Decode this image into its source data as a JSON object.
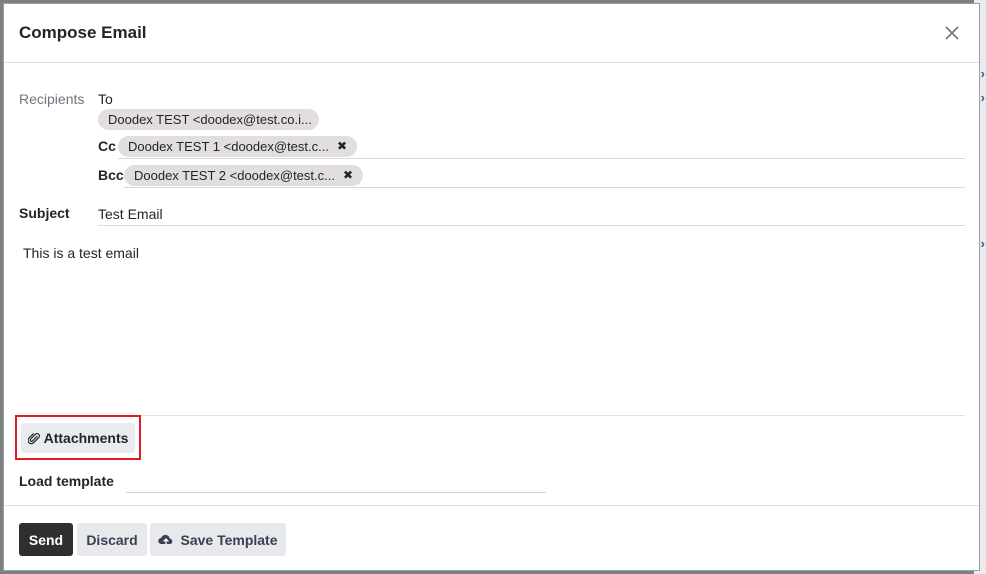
{
  "dialog": {
    "title": "Compose Email"
  },
  "recipients": {
    "section_label": "Recipients",
    "to_label": "To",
    "cc_label": "Cc",
    "bcc_label": "Bcc",
    "to": [
      "Doodex TEST <doodex@test.co.i..."
    ],
    "cc": [
      "Doodex TEST 1 <doodex@test.c..."
    ],
    "bcc": [
      "Doodex TEST 2 <doodex@test.c..."
    ]
  },
  "subject": {
    "label": "Subject",
    "value": "Test Email"
  },
  "message": {
    "body": "This is a test email"
  },
  "attachments": {
    "label": "Attachments"
  },
  "template": {
    "load_label": "Load template",
    "value": ""
  },
  "footer": {
    "send_label": "Send",
    "discard_label": "Discard",
    "save_template_label": "Save Template"
  },
  "icons": {
    "close": "close-icon",
    "remove_tag": "remove-icon",
    "attachment": "paperclip-icon",
    "save_template": "cloud-upload-icon"
  },
  "colors": {
    "highlight_border": "#e01b24",
    "primary_button": "#2f2f2f",
    "tag_background": "#e3dede"
  }
}
